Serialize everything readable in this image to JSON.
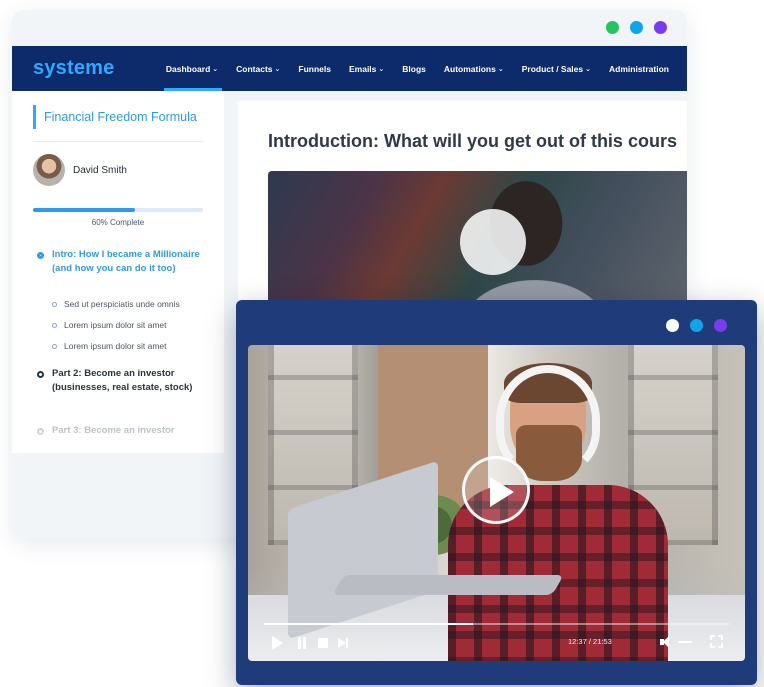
{
  "app": {
    "logo": "systeme"
  },
  "window_dots": [
    "#22c55e",
    "#0ea5e9",
    "#7c3aed"
  ],
  "video_window_dots": [
    "#ffffff",
    "#0ea5e9",
    "#7c3aed"
  ],
  "nav": {
    "items": [
      {
        "label": "Dashboard",
        "dropdown": "⌄"
      },
      {
        "label": "Contacts",
        "dropdown": "⌄"
      },
      {
        "label": "Funnels",
        "dropdown": ""
      },
      {
        "label": "Emails",
        "dropdown": "⌄"
      },
      {
        "label": "Blogs",
        "dropdown": ""
      },
      {
        "label": "Automations",
        "dropdown": "⌄"
      },
      {
        "label": "Product / Sales",
        "dropdown": "⌄"
      },
      {
        "label": "Administration",
        "dropdown": ""
      }
    ],
    "active": "Dashboard"
  },
  "sidebar": {
    "course_title": "Financial Freedom Formula",
    "author_name": "David Smith",
    "progress": {
      "percent": 60,
      "label": "60% Complete"
    },
    "lessons": [
      {
        "title": "Intro: How I became a Millionaire (and how you can do it too)",
        "state": "active",
        "sub": [
          "Sed ut perspiciatis unde omnis",
          "Lorem ipsum dolor sit amet",
          "Lorem ipsum dolor sit amet"
        ]
      },
      {
        "title": "Part 2: Become an investor (businesses, real estate, stock)",
        "state": "normal",
        "sub": []
      },
      {
        "title": "Part 3: Become an investor",
        "state": "faded",
        "sub": []
      }
    ]
  },
  "main": {
    "title": "Introduction: What will you get out of this cours"
  },
  "player": {
    "time": "12:37 / 21:53",
    "progress": 0.45,
    "volume": 0.7
  },
  "icons": [
    "play-icon",
    "pause-icon",
    "stop-icon",
    "next-icon",
    "volume-icon",
    "fullscreen-icon"
  ]
}
